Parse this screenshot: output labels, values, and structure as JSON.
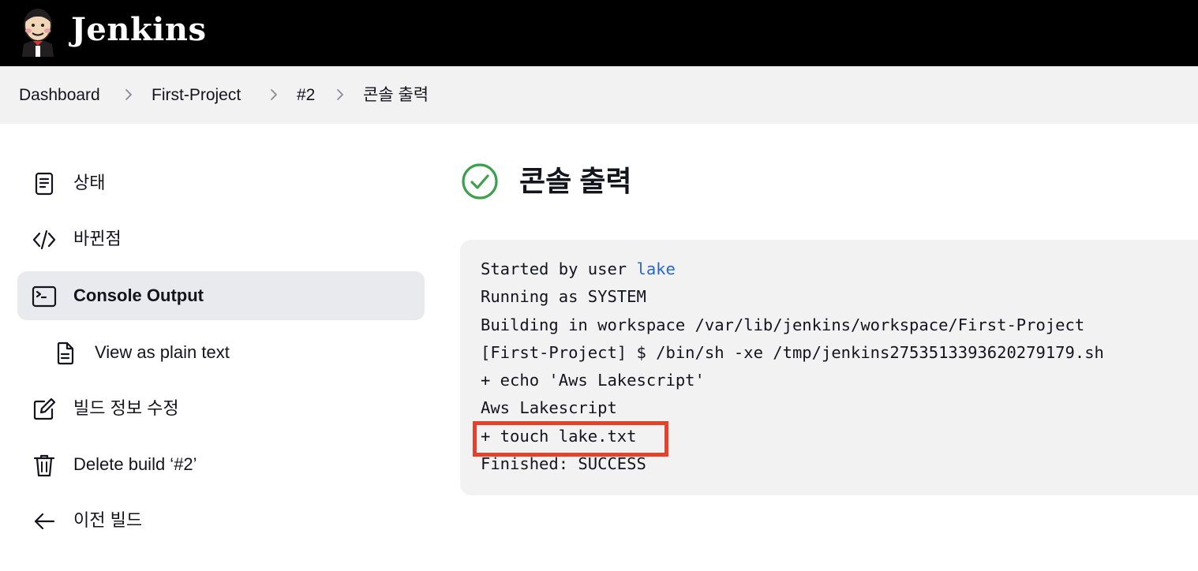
{
  "header": {
    "brand": "Jenkins",
    "logo_icon": "jenkins-butler-logo"
  },
  "breadcrumb": {
    "items": [
      "Dashboard",
      "First-Project",
      "#2",
      "콘솔 출력"
    ]
  },
  "sidebar": {
    "items": [
      {
        "label": "상태",
        "icon": "document-icon"
      },
      {
        "label": "바뀐점",
        "icon": "code-icon"
      },
      {
        "label": "Console Output",
        "icon": "terminal-icon",
        "active": true
      },
      {
        "label": "View as plain text",
        "icon": "file-text-icon"
      },
      {
        "label": "빌드 정보 수정",
        "icon": "edit-icon"
      },
      {
        "label": "Delete build ‘#2’",
        "icon": "trash-icon"
      },
      {
        "label": "이전 빌드",
        "icon": "arrow-left-icon"
      }
    ]
  },
  "main": {
    "title": "콘솔 출력",
    "status": "success",
    "status_color": "#3ca14c"
  },
  "console": {
    "started_prefix": "Started by user ",
    "user": "lake",
    "lines": [
      "Running as SYSTEM",
      "Building in workspace /var/lib/jenkins/workspace/First-Project",
      "[First-Project] $ /bin/sh -xe /tmp/jenkins2753513393620279179.sh",
      "+ echo 'Aws Lakescript'",
      "Aws Lakescript",
      "+ touch lake.txt",
      "Finished: SUCCESS"
    ],
    "highlight_color": "#e5412b",
    "link_color": "#2867d1"
  }
}
